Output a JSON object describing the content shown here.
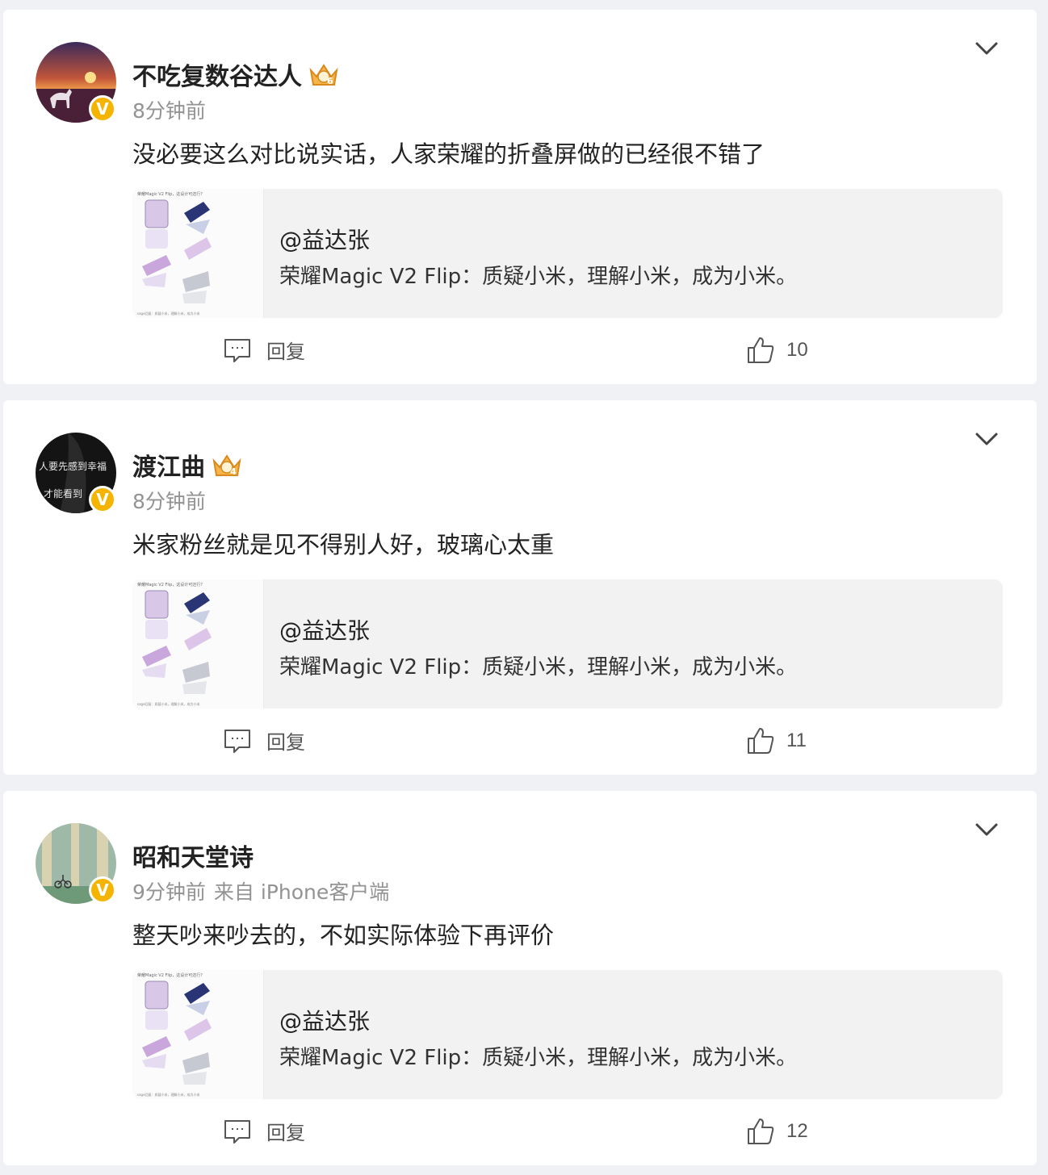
{
  "comments": [
    {
      "username": "不吃复数谷达人",
      "verified_badge": "V",
      "crown_level": "6",
      "time": "8分钟前",
      "source": "",
      "text": "没必要这么对比说实话，人家荣耀的折叠屏做的已经很不错了",
      "quote": {
        "author": "@益达张",
        "text": "荣耀Magic V2 Flip：质疑小米，理解小米，成为小米。",
        "thumb_caption": "荣耀Magic V2 Flip，这设计可还行？",
        "thumb_footer": "sage回复：质疑小米，理解小米，成为小米"
      },
      "reply_label": "回复",
      "likes": "10"
    },
    {
      "username": "渡江曲",
      "verified_badge": "V",
      "crown_level": "4",
      "time": "8分钟前",
      "source": "",
      "text": "米家粉丝就是见不得别人好，玻璃心太重",
      "quote": {
        "author": "@益达张",
        "text": "荣耀Magic V2 Flip：质疑小米，理解小米，成为小米。",
        "thumb_caption": "荣耀Magic V2 Flip，这设计可还行？",
        "thumb_footer": "sage回复：质疑小米，理解小米，成为小米"
      },
      "reply_label": "回复",
      "likes": "11"
    },
    {
      "username": "昭和天堂诗",
      "verified_badge": "V",
      "crown_level": "",
      "time": "9分钟前",
      "source": "来自 iPhone客户端",
      "text": "整天吵来吵去的，不如实际体验下再评价",
      "quote": {
        "author": "@益达张",
        "text": "荣耀Magic V2 Flip：质疑小米，理解小米，成为小米。",
        "thumb_caption": "荣耀Magic V2 Flip，这设计可还行？",
        "thumb_footer": "sage回复：质疑小米，理解小米，成为小米"
      },
      "reply_label": "回复",
      "likes": "12"
    }
  ],
  "avatar_texts": {
    "second_line1": "人要先感到幸福",
    "second_line2": "才能看到"
  },
  "icons": {
    "expand": "chevron-down-icon",
    "reply": "comment-bubble-icon",
    "like": "thumbs-up-icon",
    "crown": "crown-badge-icon",
    "verified": "verified-badge-icon"
  },
  "colors": {
    "background": "#f0f1f4",
    "card": "#ffffff",
    "quote_bg": "#f2f2f2",
    "verified": "#f5b400",
    "meta_text": "#939393"
  }
}
